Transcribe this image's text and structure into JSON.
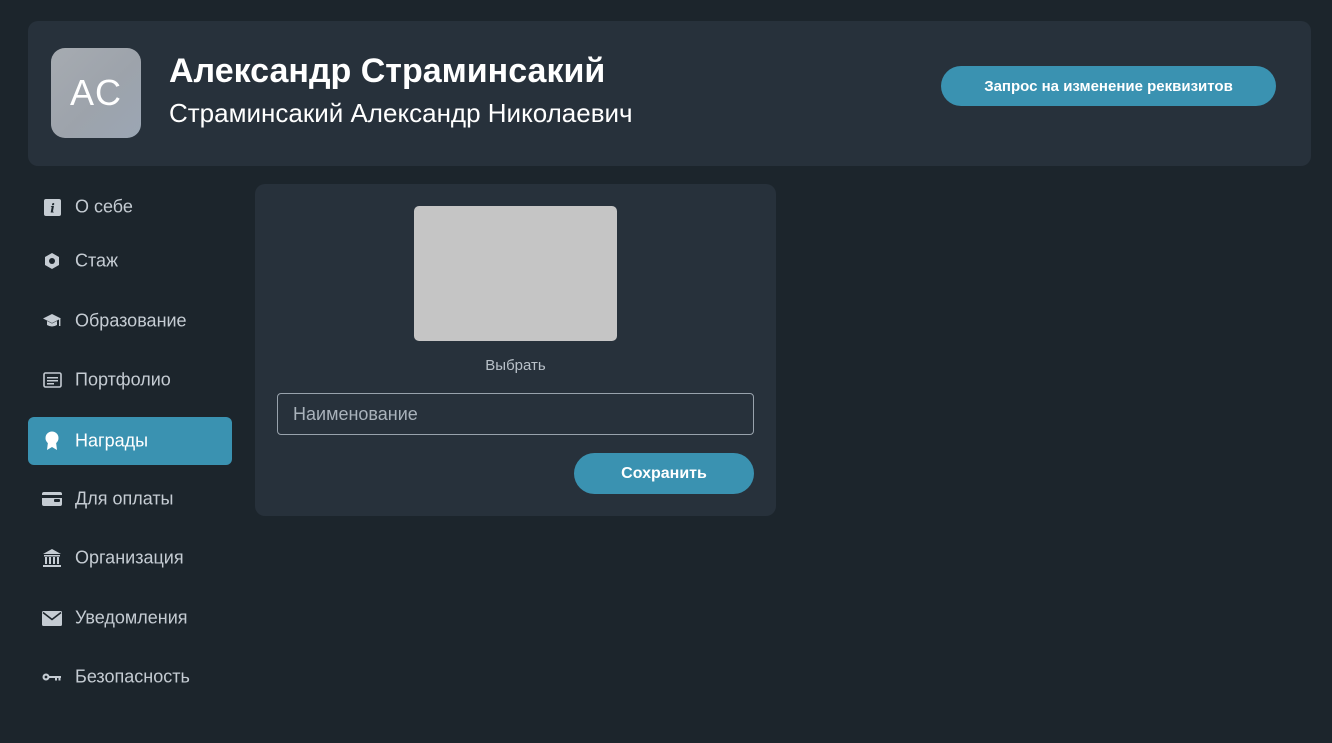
{
  "profile": {
    "initials": "AC",
    "name": "Александр Страминсакий",
    "full_name": "Страминсакий Александр Николаевич",
    "request_button_label": "Запрос на изменение реквизитов"
  },
  "sidebar": {
    "items": [
      {
        "label": "О себе",
        "icon": "info-icon",
        "active": false
      },
      {
        "label": "Стаж",
        "icon": "hexagon-icon",
        "active": false
      },
      {
        "label": "Образование",
        "icon": "graduation-cap-icon",
        "active": false
      },
      {
        "label": "Портфолио",
        "icon": "portfolio-icon",
        "active": false
      },
      {
        "label": "Награды",
        "icon": "award-icon",
        "active": true
      },
      {
        "label": "Для оплаты",
        "icon": "wallet-icon",
        "active": false
      },
      {
        "label": "Организация",
        "icon": "bank-icon",
        "active": false
      },
      {
        "label": "Уведомления",
        "icon": "envelope-icon",
        "active": false
      },
      {
        "label": "Безопасность",
        "icon": "key-icon",
        "active": false
      }
    ]
  },
  "award_form": {
    "choose_label": "Выбрать",
    "name_placeholder": "Наименование",
    "name_value": "",
    "save_label": "Сохранить"
  },
  "colors": {
    "background": "#1c252c",
    "panel": "#27313b",
    "accent": "#3a92b1",
    "nav_text": "#c5ccd3",
    "image_placeholder": "#c5c5c5"
  }
}
